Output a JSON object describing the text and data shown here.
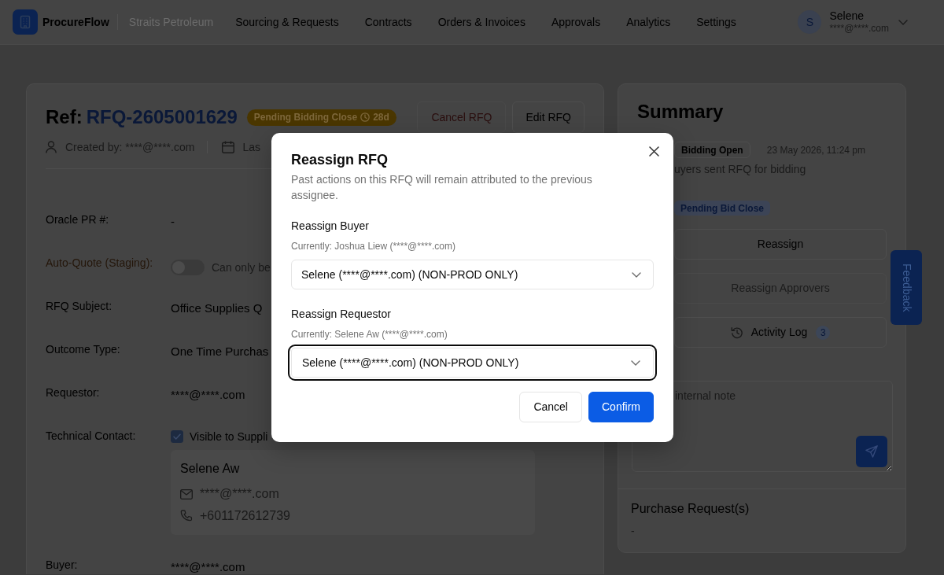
{
  "header": {
    "brand": "ProcureFlow",
    "organization": "Straits Petroleum",
    "nav": [
      "Sourcing & Requests",
      "Contracts",
      "Orders & Invoices",
      "Approvals",
      "Analytics",
      "Settings"
    ],
    "user": {
      "initial": "S",
      "name": "Selene",
      "email": "****@****.com"
    }
  },
  "rfq": {
    "ref_label": "Ref:",
    "ref_number": "RFQ-2605001629",
    "status": {
      "label": "Pending Bidding Close",
      "remaining": "28d"
    },
    "actions": [
      {
        "label": "Cancel RFQ",
        "kind": "danger"
      },
      {
        "label": "Edit RFQ",
        "kind": "default"
      }
    ],
    "created_by": "Created by: ****@****.com",
    "updated": "Las",
    "fields": [
      {
        "kind": "text",
        "label": "Oracle PR #:",
        "value": "-"
      },
      {
        "kind": "toggle",
        "label": "Auto-Quote (Staging):",
        "on": false,
        "note": "Can only be"
      },
      {
        "kind": "text",
        "label": "RFQ Subject:",
        "value": "Office Supplies Q"
      },
      {
        "kind": "text",
        "label": "Outcome Type:",
        "value": "One Time Purchas"
      },
      {
        "kind": "text",
        "label": "Requestor:",
        "value": "****@****.com"
      },
      {
        "kind": "contact",
        "label": "Technical Contact:",
        "visible": {
          "label": "Visible to Suppli",
          "checked": true
        },
        "contact": {
          "name": "Selene Aw",
          "email": "****@****.com",
          "phone": "+601172612739"
        }
      },
      {
        "kind": "text",
        "label": "Buyer:",
        "value": "****@****.com"
      }
    ]
  },
  "summary": {
    "title": "Summary",
    "timeline": [
      {
        "kind": "completed",
        "status": "Bidding Open",
        "time": "23 May 2026, 11:24 pm",
        "description": "uyers sent RFQ for bidding"
      },
      {
        "kind": "current",
        "status": "Pending Bid Close"
      }
    ],
    "actions": [
      {
        "kind": "plain",
        "label": "Reassign",
        "disabled": false
      },
      {
        "kind": "plain",
        "label": "Reassign Approvers",
        "disabled": true
      },
      {
        "kind": "log",
        "label": "Activity Log",
        "disabled": false,
        "count": "3"
      }
    ],
    "note": {
      "placeholder": "internal note"
    },
    "purchase_requests": {
      "title": "Purchase Request(s)",
      "value": "-"
    }
  },
  "feedback": "Feedback",
  "modal": {
    "title": "Reassign RFQ",
    "description": "Past actions on this RFQ will remain attributed to the previous assignee.",
    "fields": [
      {
        "label": "Reassign Buyer",
        "current": "Currently: Joshua Liew (****@****.com)",
        "value": "Selene (****@****.com) (NON-PROD ONLY)",
        "focused": false
      },
      {
        "label": "Reassign Requestor",
        "current": "Currently: Selene Aw (****@****.com)",
        "value": "Selene (****@****.com) (NON-PROD ONLY)",
        "focused": true
      }
    ],
    "buttons": [
      {
        "label": "Cancel",
        "kind": "secondary"
      },
      {
        "label": "Confirm",
        "kind": "primary"
      }
    ]
  }
}
